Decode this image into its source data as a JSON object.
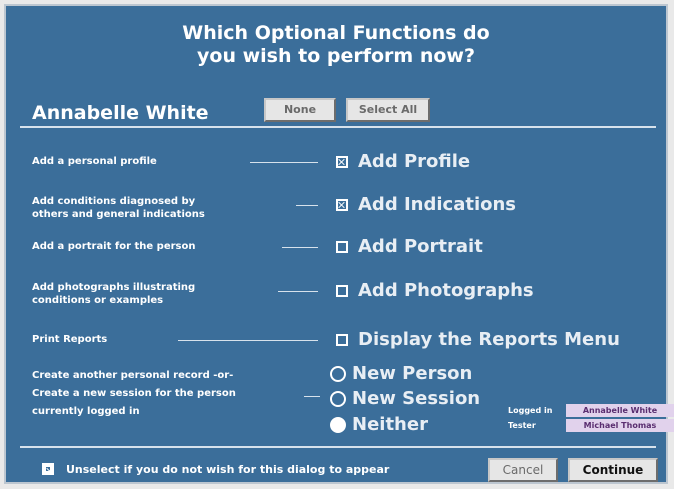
{
  "title_line1": "Which Optional Functions do",
  "title_line2": "you wish to perform now?",
  "person_name": "Annabelle White",
  "buttons": {
    "none": "None",
    "select_all": "Select All",
    "cancel": "Cancel",
    "continue": "Continue"
  },
  "rows": [
    {
      "desc_line1": "Add a personal profile",
      "desc_line2": "",
      "option": "Add Profile",
      "checked": true
    },
    {
      "desc_line1": "Add conditions diagnosed by",
      "desc_line2": "others and general indications",
      "option": "Add Indications",
      "checked": true
    },
    {
      "desc_line1": "Add a portrait for the person",
      "desc_line2": "",
      "option": "Add Portrait",
      "checked": false
    },
    {
      "desc_line1": "Add photographs illustrating",
      "desc_line2": "conditions or examples",
      "option": "Add Photographs",
      "checked": false
    },
    {
      "desc_line1": "Print Reports",
      "desc_line2": "",
      "option": "Display the Reports Menu",
      "checked": false
    }
  ],
  "create_desc": {
    "line1": "Create another personal record  -or-",
    "line2": "Create a new session for the person",
    "line3": "currently logged in"
  },
  "radios": [
    {
      "label": "New Person",
      "selected": false
    },
    {
      "label": "New Session",
      "selected": false
    },
    {
      "label": "Neither",
      "selected": true
    }
  ],
  "login": {
    "logged_in_label": "Logged in",
    "logged_in_value": "Annabelle White",
    "tester_label": "Tester",
    "tester_value": "Michael Thomas"
  },
  "footer_text": "Unselect if you do not wish for this dialog to appear",
  "footer_checked": true
}
